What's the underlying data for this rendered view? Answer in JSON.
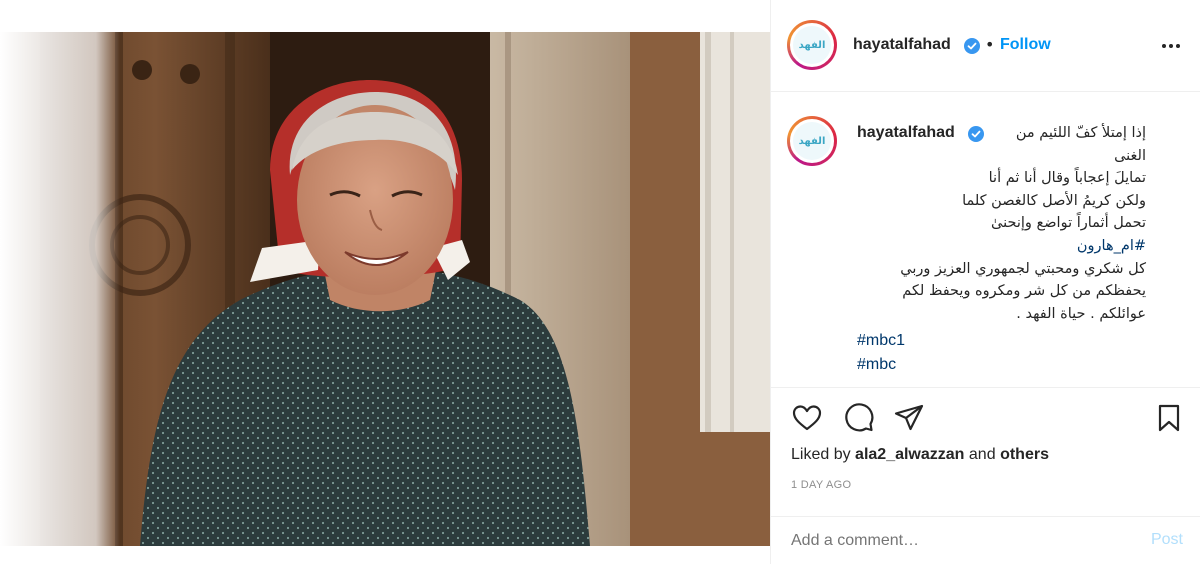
{
  "post": {
    "photo_alt": "Smiling elderly woman in a red headscarf and dark patterned dress standing in a wooden doorway",
    "username": "hayatalfahad",
    "verified": true,
    "separator": "•",
    "follow_label": "Follow",
    "more_icon": "more-options-icon",
    "avatar_logo_text": "الفهد",
    "caption": {
      "username": "hayatalfahad",
      "lines": [
        "إذا إمتلأ كفّ اللئيم من",
        "الغنى",
        "تمايلَ إعجاباً وقال أنا ثم أنا",
        "ولكن كريمُ الأصل كالغصن كلما",
        "تحمل أثماراً تواضع وإنحنىٰ",
        "#ام_هارون",
        "كل شكري ومحبتي لجمهوري العزيز وربي",
        "يحفظكم من كل شر ومكروه ويحفظ لكم",
        "عوائلكم . حياة الفهد ."
      ],
      "hashtags": [
        "#mbc1",
        "#mbc"
      ]
    },
    "actions": {
      "like_icon": "heart-icon",
      "comment_icon": "comment-icon",
      "share_icon": "share-icon",
      "save_icon": "bookmark-icon"
    },
    "likes": {
      "prefix": "Liked by",
      "user": "ala2_alwazzan",
      "middle": "and",
      "others": "others"
    },
    "time_ago": "1 DAY AGO",
    "comment": {
      "placeholder": "Add a comment…",
      "post_label": "Post"
    }
  },
  "colors": {
    "accent": "#0095f6",
    "link": "#00376b",
    "muted": "#8e8e8e",
    "post_disabled": "#b2dffc",
    "border": "#efefef"
  }
}
